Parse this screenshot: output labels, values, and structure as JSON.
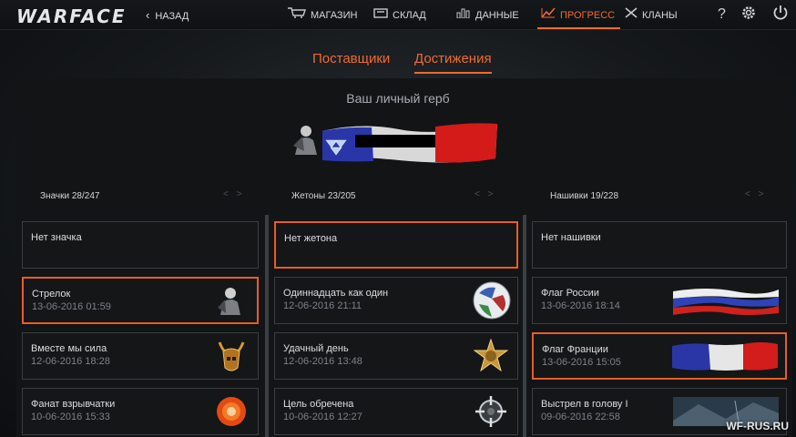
{
  "app": {
    "logo": "WARFACE"
  },
  "nav": {
    "back": "НАЗАД",
    "items": [
      {
        "label": "МАГАЗИН",
        "icon": "cart-icon"
      },
      {
        "label": "СКЛАД",
        "icon": "warehouse-icon"
      },
      {
        "label": "ДАННЫЕ",
        "icon": "stats-icon"
      },
      {
        "label": "ПРОГРЕСС",
        "icon": "progress-icon",
        "active": true
      },
      {
        "label": "КЛАНЫ",
        "icon": "clans-icon"
      }
    ],
    "help": "?"
  },
  "tabs": [
    {
      "label": "Поставщики"
    },
    {
      "label": "Достижения",
      "active": true
    }
  ],
  "emblem": {
    "title": "Ваш личный герб"
  },
  "columns": [
    {
      "header": "Значки 28/247",
      "cards": [
        {
          "name": "Нет значка",
          "date": ""
        },
        {
          "name": "Стрелок",
          "date": "13-06-2016 01:59",
          "selected": true
        },
        {
          "name": "Вместе мы сила",
          "date": "12-06-2016 18:28"
        },
        {
          "name": "Фанат взрывчатки",
          "date": "10-06-2016 15:33"
        }
      ]
    },
    {
      "header": "Жетоны 23/205",
      "cards": [
        {
          "name": "Нет жетона",
          "date": "",
          "selected": true
        },
        {
          "name": "Одиннадцать как один",
          "date": "12-06-2016 21:11"
        },
        {
          "name": "Удачный день",
          "date": "12-06-2016 13:48"
        },
        {
          "name": "Цель обречена",
          "date": "10-06-2016 12:27"
        }
      ]
    },
    {
      "header": "Нашивки 19/228",
      "cards": [
        {
          "name": "Нет нашивки",
          "date": ""
        },
        {
          "name": "Флаг России",
          "date": "13-06-2016 18:14"
        },
        {
          "name": "Флаг Франции",
          "date": "13-06-2016 15:05",
          "selected": true
        },
        {
          "name": "Выстрел в голову I",
          "date": "09-06-2016 22:58"
        }
      ]
    }
  ],
  "pager": "< >",
  "watermark": "WF-RUS.RU",
  "colors": {
    "accent": "#ef6a2f",
    "selected_border": "#e85d25",
    "background": "#0d0f11"
  }
}
